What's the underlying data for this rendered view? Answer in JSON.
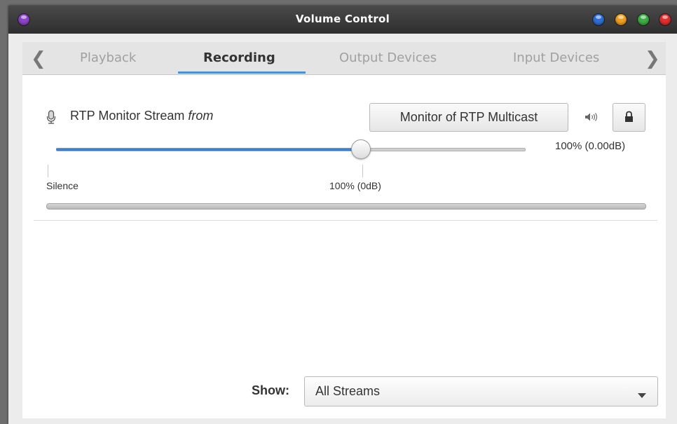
{
  "window": {
    "title": "Volume Control"
  },
  "titlebar": {
    "left_button": {
      "icon": "menu-orb-icon",
      "color": "#8e44c9"
    },
    "buttons": [
      {
        "name": "stick-button",
        "icon": "blue-orb-icon",
        "color": "#2f6fd6"
      },
      {
        "name": "minimize-button",
        "icon": "orange-orb-icon",
        "color": "#f0a020"
      },
      {
        "name": "maximize-button",
        "icon": "green-orb-icon",
        "color": "#3cb043"
      },
      {
        "name": "close-button",
        "icon": "red-orb-icon",
        "color": "#e03030"
      }
    ]
  },
  "tabs": {
    "prev_icon": "chevron-left-icon",
    "next_icon": "chevron-right-icon",
    "items": [
      {
        "label": "Playback",
        "active": false
      },
      {
        "label": "Recording",
        "active": true
      },
      {
        "label": "Output Devices",
        "active": false
      },
      {
        "label": "Input Devices",
        "active": false
      }
    ],
    "accent_color": "#4a90d9"
  },
  "stream": {
    "icon": "microphone-icon",
    "name": "RTP Monitor Stream",
    "from_label": "from",
    "source_button": "Monitor of RTP Multicast",
    "mute_icon": "speaker-icon",
    "lock_icon": "lock-icon",
    "volume_readout": "100% (0.00dB)",
    "volume_fraction": 0.65,
    "scale_min_label": "Silence",
    "scale_mark_label": "100% (0dB)"
  },
  "footer": {
    "show_label": "Show:",
    "show_value": "All Streams",
    "dropdown_icon": "triangle-down-icon"
  }
}
